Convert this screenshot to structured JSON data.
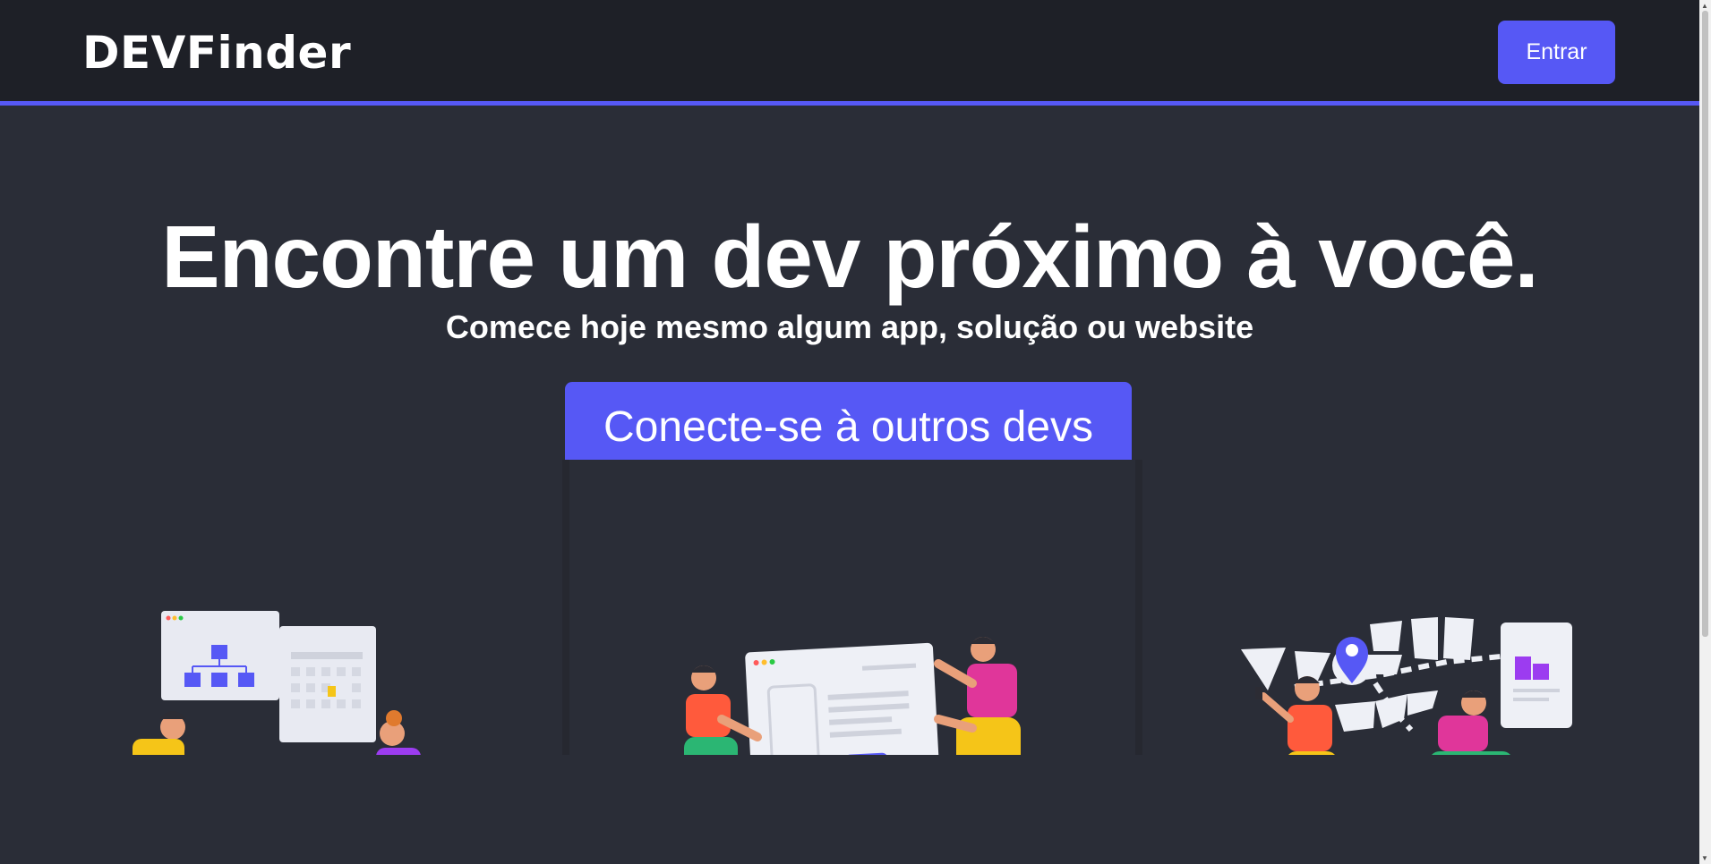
{
  "header": {
    "logo": "DEVFinder",
    "login_label": "Entrar"
  },
  "hero": {
    "title": "Encontre um dev próximo à você.",
    "subtitle": "Comece hoje mesmo algum app, solução ou website",
    "cta_label": "Conecte-se à outros devs"
  },
  "illustrations": [
    {
      "icon": "team-meeting-illustration"
    },
    {
      "icon": "web-design-illustration"
    },
    {
      "icon": "location-map-illustration"
    }
  ],
  "colors": {
    "accent": "#5658f5",
    "background": "#2a2d37",
    "header_bg": "#1e2027"
  }
}
